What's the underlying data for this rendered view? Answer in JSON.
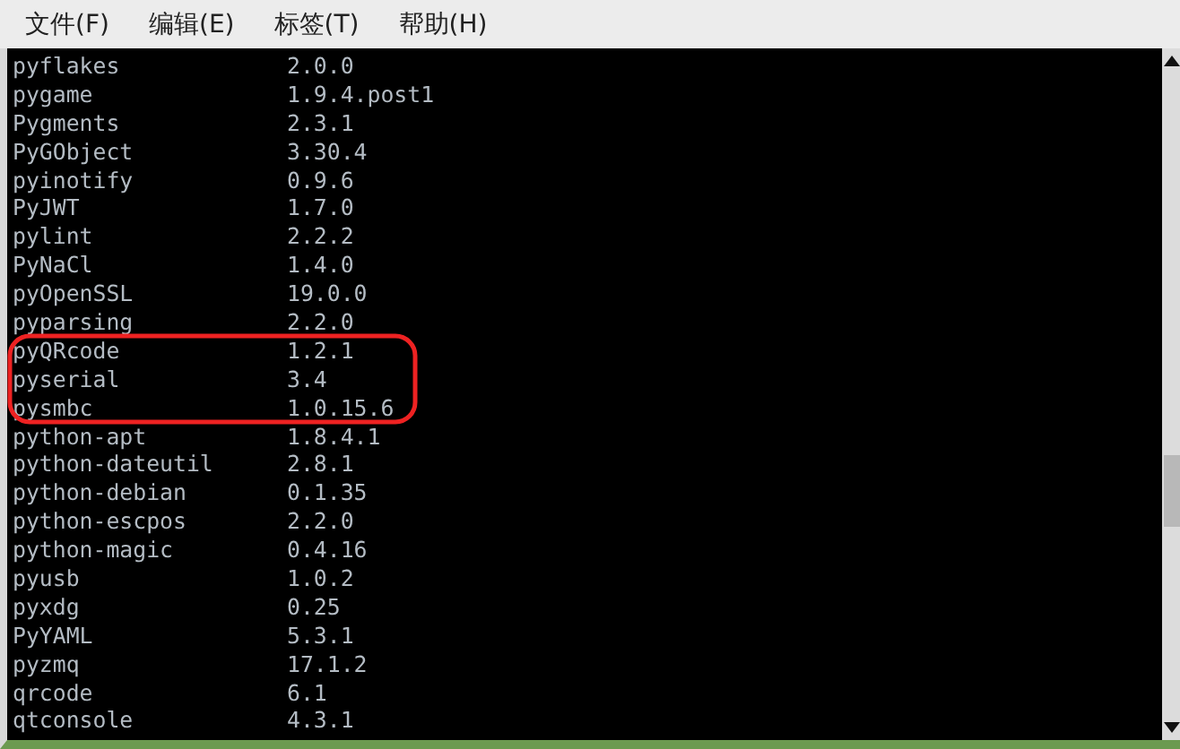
{
  "menu": [
    "文件(F)",
    "编辑(E)",
    "标签(T)",
    "帮助(H)"
  ],
  "packages": [
    {
      "name": "pyflakes",
      "version": "2.0.0"
    },
    {
      "name": "pygame",
      "version": "1.9.4.post1"
    },
    {
      "name": "Pygments",
      "version": "2.3.1"
    },
    {
      "name": "PyGObject",
      "version": "3.30.4"
    },
    {
      "name": "pyinotify",
      "version": "0.9.6"
    },
    {
      "name": "PyJWT",
      "version": "1.7.0"
    },
    {
      "name": "pylint",
      "version": "2.2.2"
    },
    {
      "name": "PyNaCl",
      "version": "1.4.0"
    },
    {
      "name": "pyOpenSSL",
      "version": "19.0.0"
    },
    {
      "name": "pyparsing",
      "version": "2.2.0"
    },
    {
      "name": "pyQRcode",
      "version": "1.2.1"
    },
    {
      "name": "pyserial",
      "version": "3.4"
    },
    {
      "name": "pysmbc",
      "version": "1.0.15.6"
    },
    {
      "name": "python-apt",
      "version": "1.8.4.1"
    },
    {
      "name": "python-dateutil",
      "version": "2.8.1"
    },
    {
      "name": "python-debian",
      "version": "0.1.35"
    },
    {
      "name": "python-escpos",
      "version": "2.2.0"
    },
    {
      "name": "python-magic",
      "version": "0.4.16"
    },
    {
      "name": "pyusb",
      "version": "1.0.2"
    },
    {
      "name": "pyxdg",
      "version": "0.25"
    },
    {
      "name": "PyYAML",
      "version": "5.3.1"
    },
    {
      "name": "pyzmq",
      "version": "17.1.2"
    },
    {
      "name": "qrcode",
      "version": "6.1"
    },
    {
      "name": "qtconsole",
      "version": "4.3.1"
    }
  ]
}
